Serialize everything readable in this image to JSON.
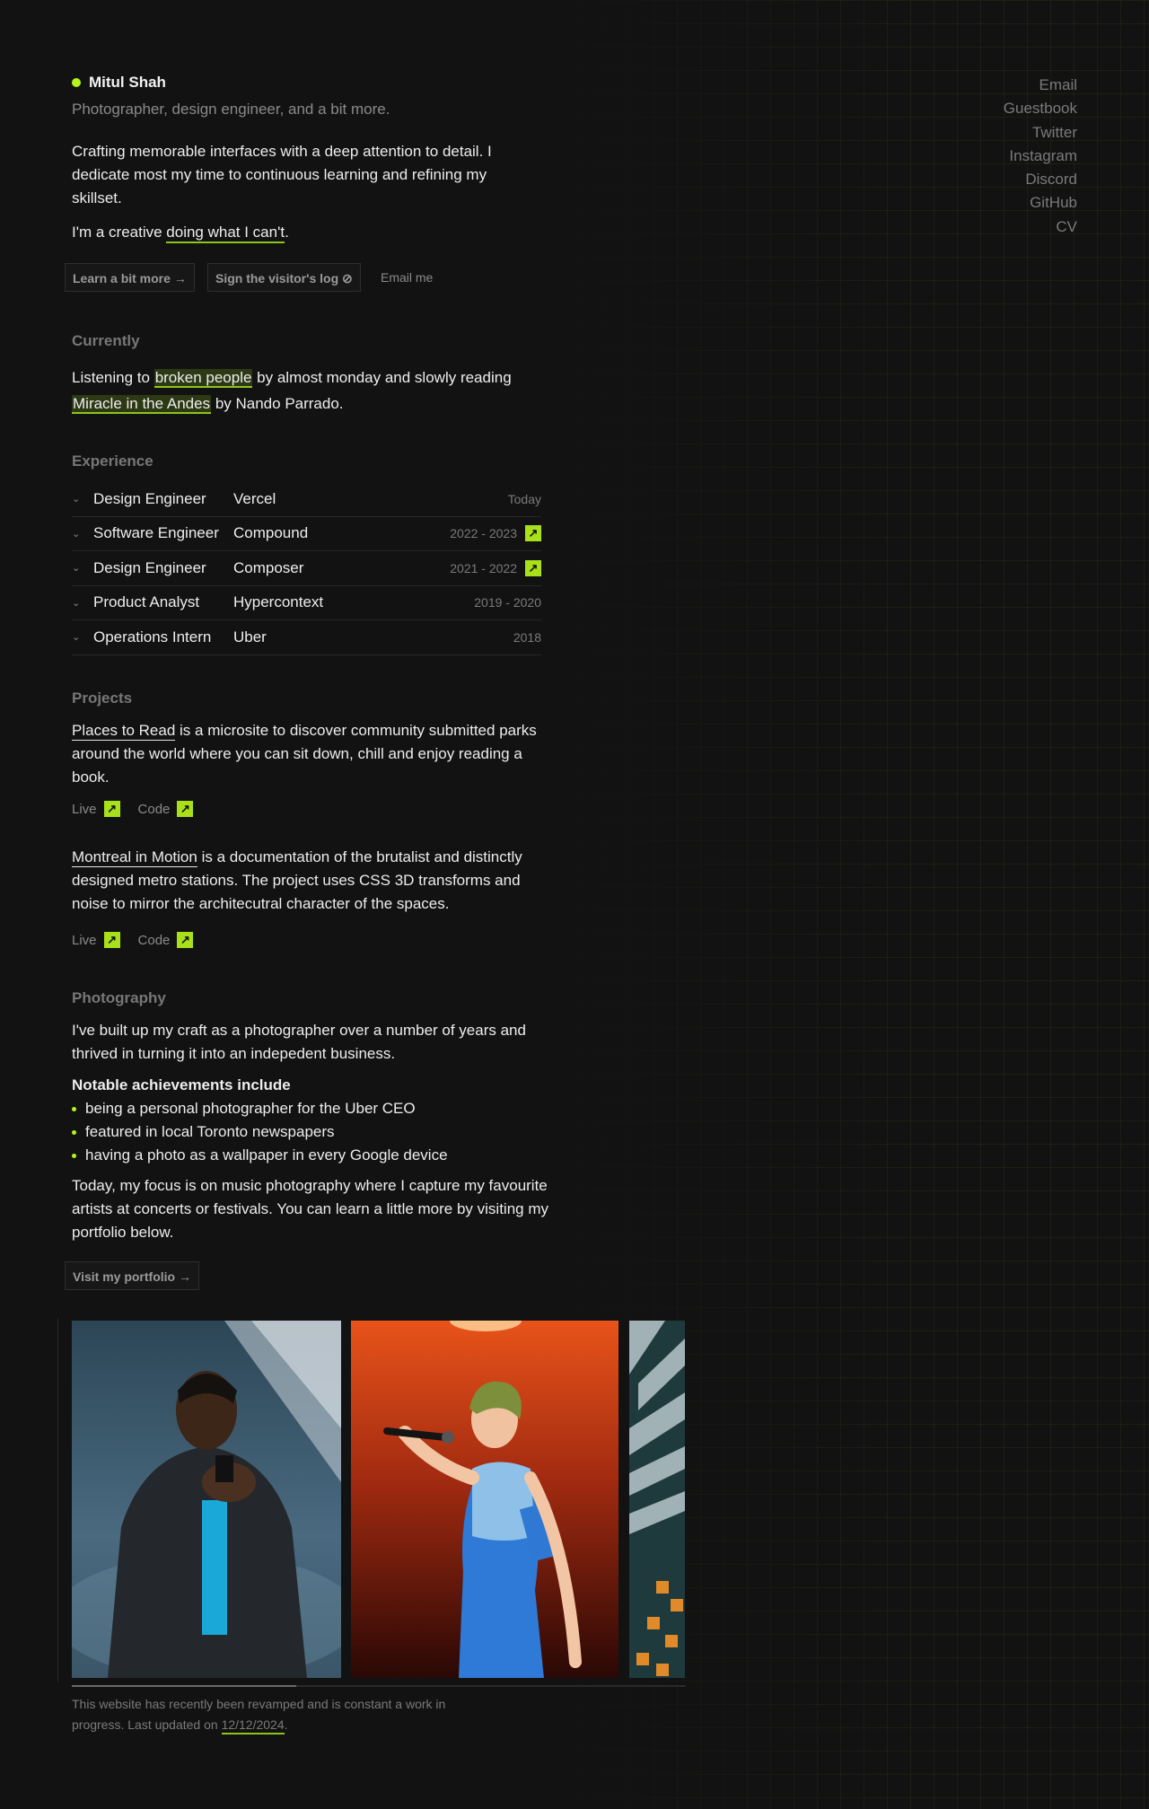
{
  "profile": {
    "name": "Mitul Shah",
    "tagline": "Photographer, design engineer, and a bit more.",
    "intro": "Crafting memorable interfaces with a deep attention to detail. I dedicate most my time to continuous learning and refining my skillset.",
    "creative_prefix": "I'm a creative ",
    "creative_link": "doing what I can't",
    "creative_suffix": "."
  },
  "buttons": {
    "learn_more": "Learn a bit more →",
    "sign_log": "Sign the visitor's log ⊘",
    "email_me": "Email me"
  },
  "nav": [
    "Email",
    "Guestbook",
    "Twitter",
    "Instagram",
    "Discord",
    "GitHub",
    "CV"
  ],
  "currently": {
    "heading": "Currently",
    "t1": "Listening to ",
    "music": "broken people",
    "t2": " by almost monday and slowly reading",
    "book": "Miracle in the Andes",
    "t3": " by Nando Parrado."
  },
  "experience": {
    "heading": "Experience",
    "rows": [
      {
        "role": "Design Engineer",
        "company": "Vercel",
        "dates": "Today",
        "link": false
      },
      {
        "role": "Software Engineer",
        "company": "Compound",
        "dates": "2022 - 2023",
        "link": true
      },
      {
        "role": "Design Engineer",
        "company": "Composer",
        "dates": "2021 - 2022",
        "link": true
      },
      {
        "role": "Product Analyst",
        "company": "Hypercontext",
        "dates": "2019 - 2020",
        "link": false
      },
      {
        "role": "Operations Intern",
        "company": "Uber",
        "dates": "2018",
        "link": false
      }
    ]
  },
  "projects": {
    "heading": "Projects",
    "items": [
      {
        "name": "Places to Read",
        "desc": " is a microsite to discover community submitted parks around the world where you can sit down, chill and enjoy reading a book.",
        "live": "Live",
        "code": "Code"
      },
      {
        "name": "Montreal in Motion",
        "desc": " is a documentation of the brutalist and distinctly designed metro stations. The project uses CSS 3D transforms and noise to mirror the architecutral character of the spaces.",
        "live": "Live",
        "code": "Code"
      }
    ]
  },
  "photography": {
    "heading": "Photography",
    "p1": "I've built up my craft as a photographer over a number of years and thrived in turning it into an indepedent business.",
    "achievements_heading": "Notable achievements include",
    "achievements": [
      "being a personal photographer for the Uber CEO",
      "featured in local Toronto newspapers",
      "having a photo as a wallpaper in every Google device"
    ],
    "p2": "Today, my focus is on music photography where I capture my favourite artists at concerts or festivals. You can learn a little more by visiting my portfolio below.",
    "portfolio_button": "Visit my portfolio →"
  },
  "footer": {
    "text": "This website has recently been revamped and is constant a work in progress. Last updated on ",
    "date": "12/12/2024",
    "end": "."
  },
  "colors": {
    "accent": "#b6f31c",
    "background": "#121212",
    "underline": "#8ec51b"
  }
}
